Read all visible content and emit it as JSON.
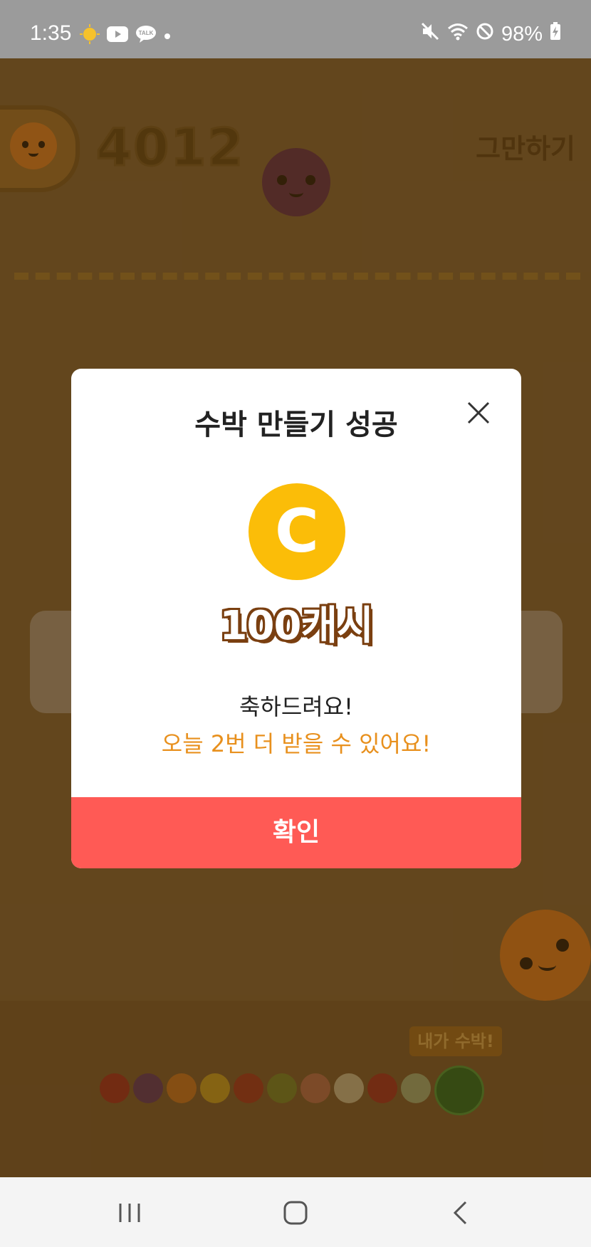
{
  "status_bar": {
    "time": "1:35",
    "battery": "98%",
    "left_icons": [
      "weather-sun-icon",
      "youtube-icon",
      "kakaotalk-icon",
      "dot-icon"
    ],
    "kakaotalk_label": "TALK",
    "right_icons": [
      "mute-icon",
      "wifi-icon",
      "do-not-disturb-icon",
      "battery-charging-icon"
    ]
  },
  "game": {
    "score": "4012",
    "quit_label": "그만하기",
    "tag_label": "내가 수박!"
  },
  "modal": {
    "title": "수박 만들기 성공",
    "reward": "100캐시",
    "coin_letter": "C",
    "message_line1": "축하드려요!",
    "message_line2": "오늘 2번 더 받을 수 있어요!",
    "confirm_label": "확인"
  },
  "colors": {
    "accent_orange": "#e8901d",
    "confirm_red": "#ff5a55",
    "coin_yellow": "#fbbd08"
  },
  "navbar": {
    "icons": [
      "recent-apps-icon",
      "home-icon",
      "back-icon"
    ]
  }
}
